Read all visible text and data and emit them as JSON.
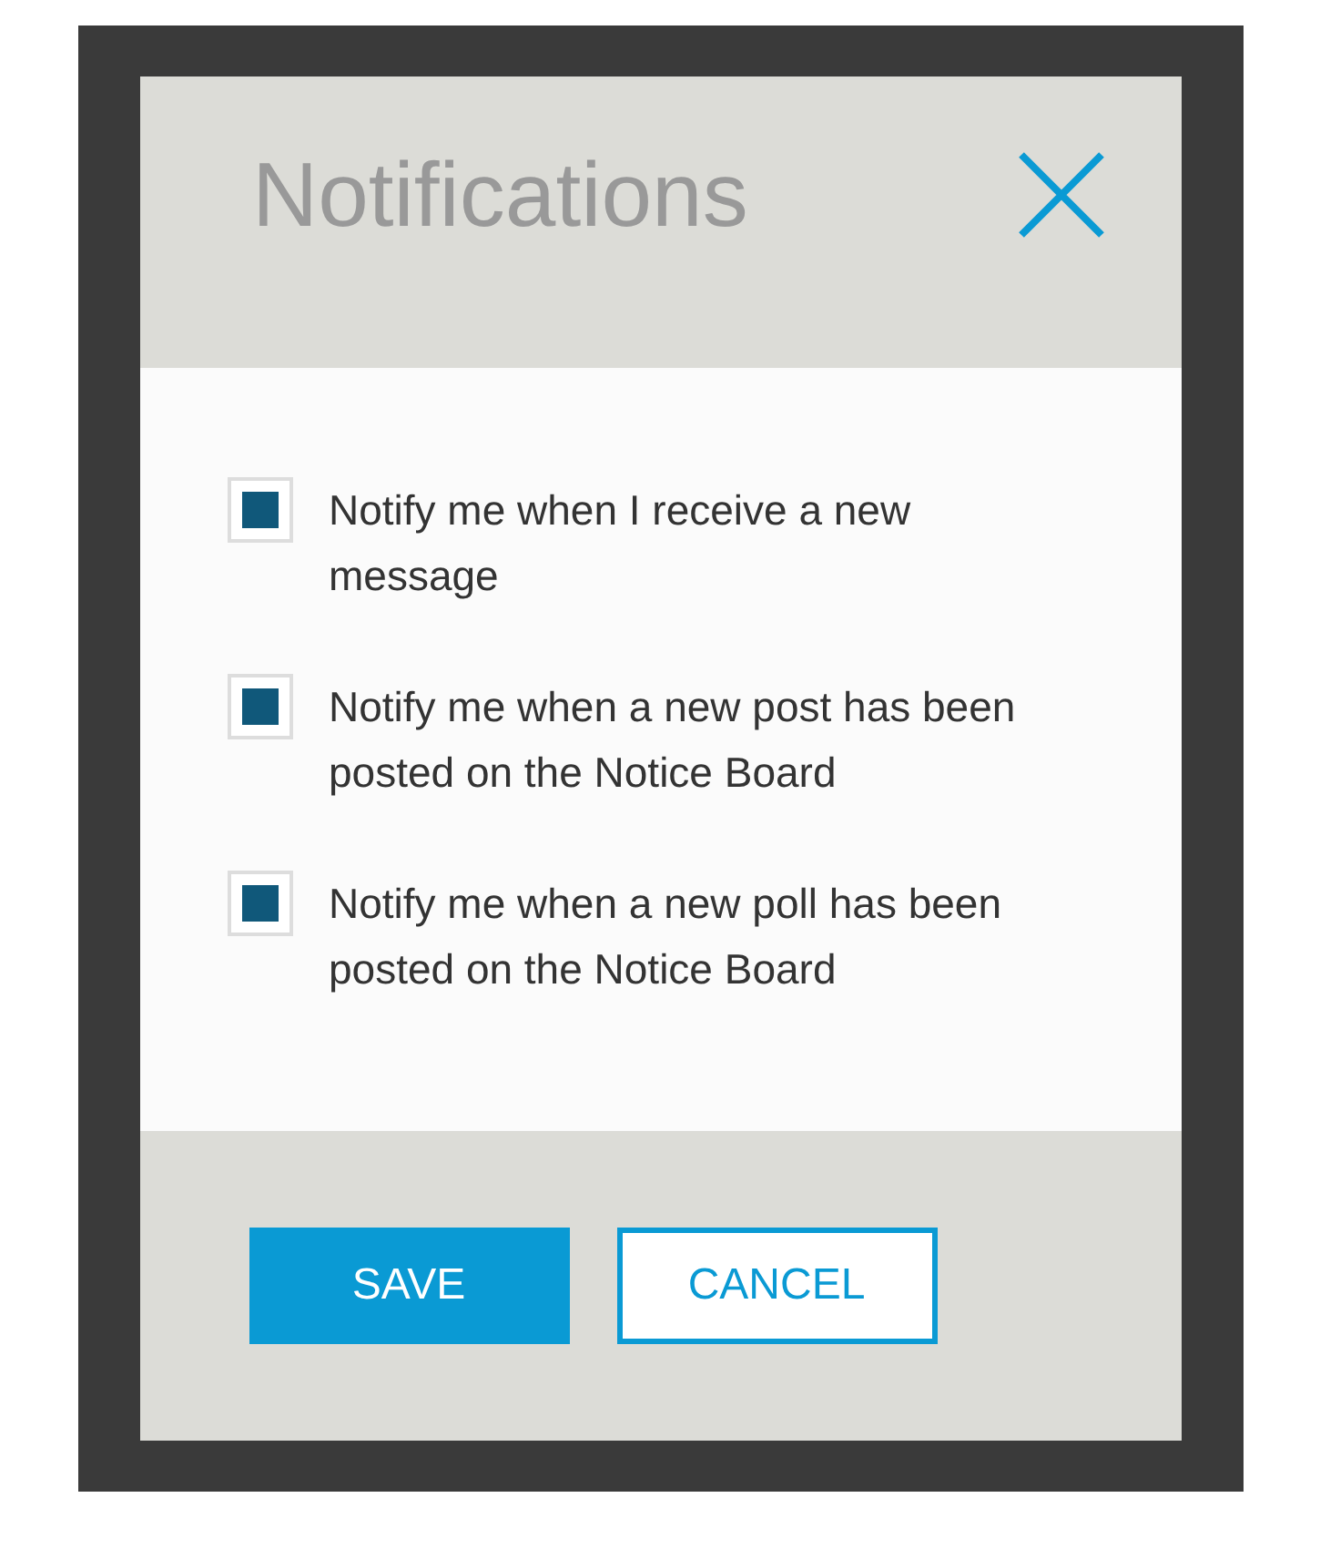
{
  "dialog": {
    "title": "Notifications",
    "options": [
      {
        "label": "Notify me when I receive a new message",
        "checked": true
      },
      {
        "label": "Notify me when a new post has been posted on the Notice Board",
        "checked": true
      },
      {
        "label": "Notify me when a new poll has been posted on the Notice Board",
        "checked": true
      }
    ],
    "buttons": [
      {
        "label": "SAVE",
        "kind": "primary"
      },
      {
        "label": "CANCEL",
        "kind": "secondary"
      }
    ]
  }
}
